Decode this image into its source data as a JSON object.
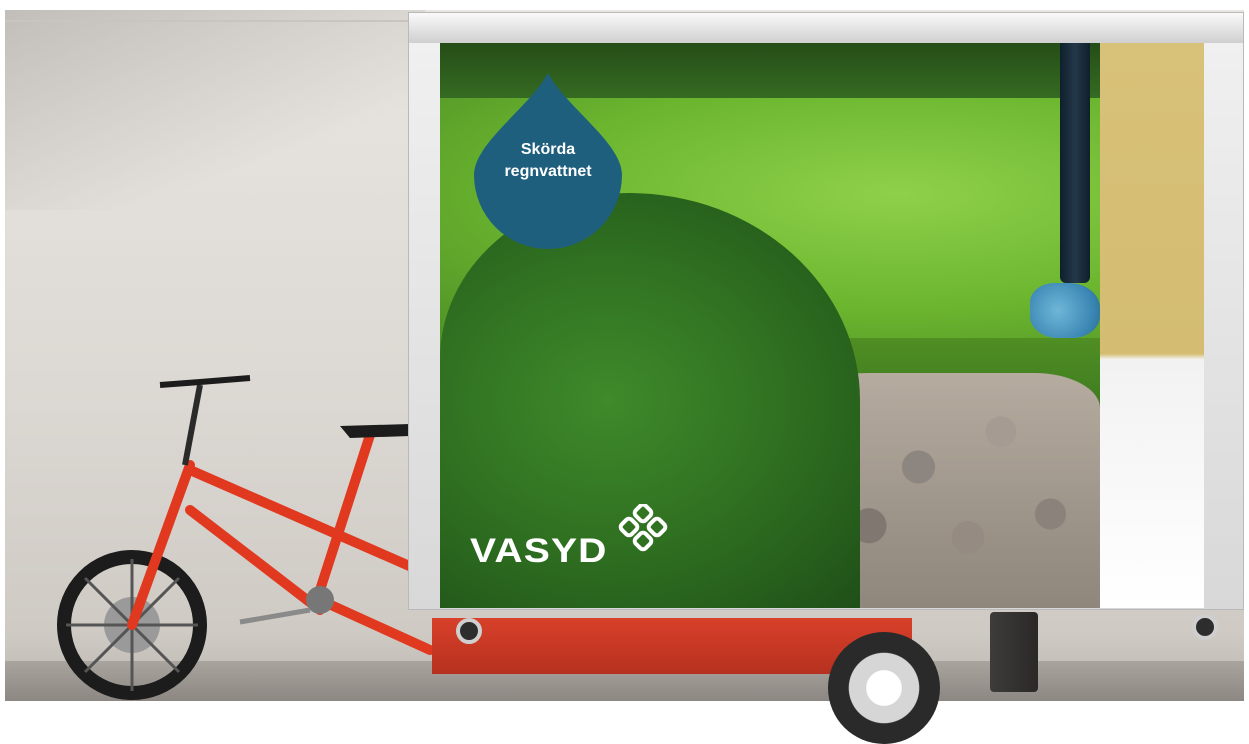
{
  "badge": {
    "line1": "Skörda",
    "line2": "regnvattnet",
    "color": "#1f5f7e"
  },
  "logo": {
    "brand": "VASYD",
    "color": "#ffffff"
  },
  "scene": {
    "bike_frame_color": "#e0391f",
    "trailer_color": "#c9361f"
  }
}
